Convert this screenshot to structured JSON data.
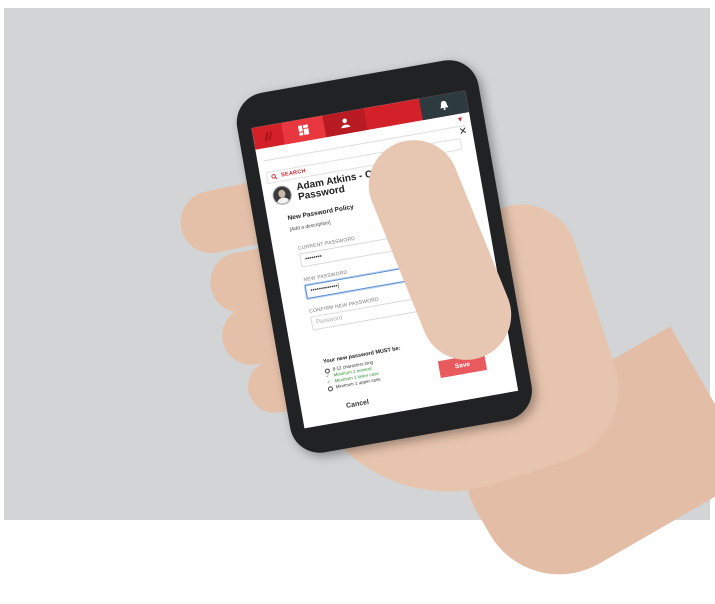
{
  "nav": {
    "items": [
      {
        "name": "logo",
        "icon": "brand-logo-icon"
      },
      {
        "name": "dashboard",
        "icon": "dashboard-icon"
      },
      {
        "name": "user",
        "icon": "user-icon"
      },
      {
        "name": "notifications",
        "icon": "bell-icon"
      }
    ],
    "brand_color": "#d22129"
  },
  "search": {
    "label": "SEARCH",
    "icon": "search-icon"
  },
  "dialog": {
    "title": "Adam Atkins - Change Password",
    "close_icon": "close-icon",
    "policy_title": "New Password Policy",
    "policy_description": "[Add a description]"
  },
  "fields": {
    "current": {
      "label": "CURRENT PASSWORD",
      "value": "••••••••"
    },
    "new": {
      "label": "NEW PASSWORD",
      "value": "•••••••••••••|"
    },
    "confirm": {
      "label": "CONFIRM NEW PASSWORD",
      "placeholder": "Password"
    }
  },
  "requirements": {
    "heading": "Your new password MUST be:",
    "items": [
      {
        "text": "8-12 characters long",
        "met": false
      },
      {
        "text": "Minimum 1 numeric",
        "met": true
      },
      {
        "text": "Minimum 1 lower case",
        "met": true
      },
      {
        "text": "Minimum 1 upper case",
        "met": false
      }
    ]
  },
  "actions": {
    "save": "Save",
    "cancel": "Cancel"
  }
}
